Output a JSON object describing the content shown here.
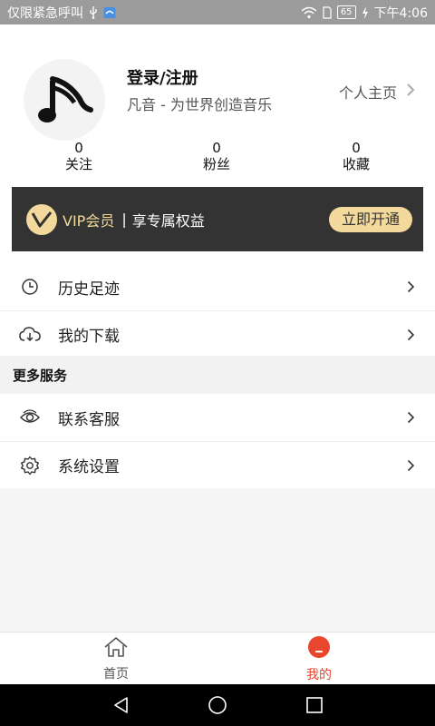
{
  "status_bar": {
    "left_text": "仅限紧急呼叫",
    "battery": "65",
    "time": "下午4:06"
  },
  "profile": {
    "login_title": "登录/注册",
    "slogan": "凡音 - 为世界创造音乐",
    "homepage_label": "个人主页"
  },
  "stats": [
    {
      "count": "0",
      "label": "关注"
    },
    {
      "count": "0",
      "label": "粉丝"
    },
    {
      "count": "0",
      "label": "收藏"
    }
  ],
  "vip": {
    "title": "VIP会员",
    "separator": "|",
    "subtitle": "享专属权益",
    "button": "立即开通",
    "gold": "#f3d99b",
    "background": "#333333"
  },
  "menu_main": [
    {
      "label": "历史足迹",
      "icon": "clock-icon"
    },
    {
      "label": "我的下载",
      "icon": "cloud-download-icon"
    }
  ],
  "more_services": {
    "header": "更多服务",
    "items": [
      {
        "label": "联系客服",
        "icon": "eye-icon"
      },
      {
        "label": "系统设置",
        "icon": "gear-icon"
      }
    ]
  },
  "tabbar": {
    "home": "首页",
    "mine": "我的",
    "active_color": "#e8462d",
    "inactive_color": "#555555"
  }
}
